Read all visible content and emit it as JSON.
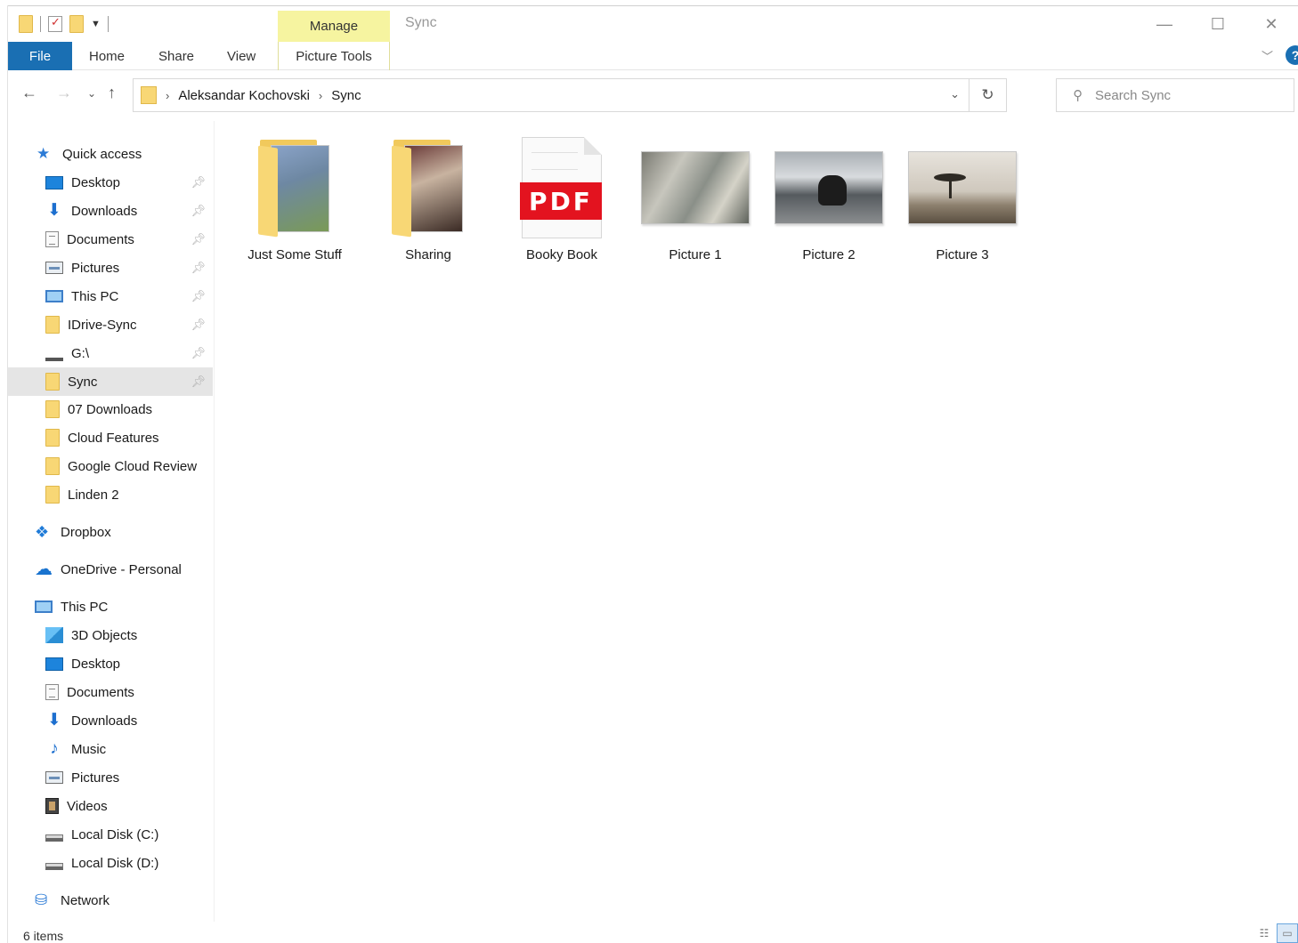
{
  "window": {
    "title": "Sync",
    "manage_tab": "Manage",
    "controls": {
      "minimize": "—",
      "maximize": "☐",
      "close": "✕"
    }
  },
  "ribbon": {
    "file": "File",
    "home": "Home",
    "share": "Share",
    "view": "View",
    "picture_tools": "Picture Tools",
    "help": "?"
  },
  "address": {
    "crumbs": [
      "Aleksandar Kochovski",
      "Sync"
    ],
    "separator": "›"
  },
  "search": {
    "placeholder": "Search Sync"
  },
  "nav": {
    "quick_access": "Quick access",
    "quick_items": [
      {
        "label": "Desktop",
        "icon": "desktop-icon"
      },
      {
        "label": "Downloads",
        "icon": "downloads-icon"
      },
      {
        "label": "Documents",
        "icon": "documents-icon"
      },
      {
        "label": "Pictures",
        "icon": "pictures-icon"
      },
      {
        "label": "This PC",
        "icon": "computer-icon"
      },
      {
        "label": "IDrive-Sync",
        "icon": "folder-icon"
      },
      {
        "label": "G:\\",
        "icon": "drive-icon"
      },
      {
        "label": "Sync",
        "icon": "folder-icon"
      },
      {
        "label": "07 Downloads",
        "icon": "folder-icon"
      },
      {
        "label": "Cloud Features",
        "icon": "folder-icon"
      },
      {
        "label": "Google Cloud Review",
        "icon": "folder-icon"
      },
      {
        "label": "Linden 2",
        "icon": "folder-icon"
      }
    ],
    "dropbox": "Dropbox",
    "onedrive": "OneDrive - Personal",
    "this_pc": "This PC",
    "pc_items": [
      {
        "label": "3D Objects",
        "icon": "3d-objects-icon"
      },
      {
        "label": "Desktop",
        "icon": "desktop-icon"
      },
      {
        "label": "Documents",
        "icon": "documents-icon"
      },
      {
        "label": "Downloads",
        "icon": "downloads-icon"
      },
      {
        "label": "Music",
        "icon": "music-icon"
      },
      {
        "label": "Pictures",
        "icon": "pictures-icon"
      },
      {
        "label": "Videos",
        "icon": "videos-icon"
      },
      {
        "label": "Local Disk (C:)",
        "icon": "disk-icon"
      },
      {
        "label": "Local Disk (D:)",
        "icon": "disk-icon"
      }
    ],
    "network": "Network"
  },
  "files": [
    {
      "name": "Just Some Stuff",
      "type": "folder"
    },
    {
      "name": "Sharing",
      "type": "folder"
    },
    {
      "name": "Booky Book",
      "type": "pdf",
      "badge": "PDF"
    },
    {
      "name": "Picture 1",
      "type": "image"
    },
    {
      "name": "Picture 2",
      "type": "image"
    },
    {
      "name": "Picture 3",
      "type": "image"
    }
  ],
  "status": {
    "item_count": "6 items"
  }
}
